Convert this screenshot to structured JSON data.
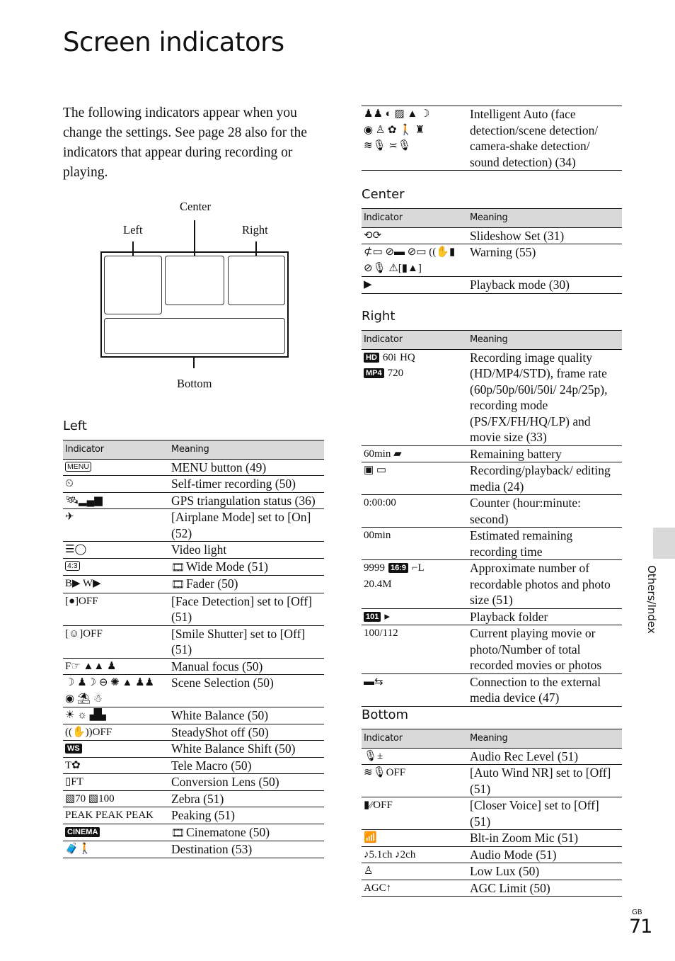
{
  "page": {
    "title": "Screen indicators",
    "intro": "The following indicators appear when you change the settings. See page 28 also for the indicators that appear during recording or playing.",
    "side_tab": "Others/Index",
    "region_code": "GB",
    "page_number": "71"
  },
  "diagram": {
    "labels": {
      "center": "Center",
      "left": "Left",
      "right": "Right",
      "bottom": "Bottom"
    }
  },
  "headers": {
    "indicator": "Indicator",
    "meaning": "Meaning"
  },
  "left": {
    "title": "Left",
    "rows": [
      {
        "icons": [
          "menu-box"
        ],
        "icon_text": "MENU",
        "meaning": "MENU button (49)"
      },
      {
        "icons": [
          "self-timer-icon"
        ],
        "icon_text": "⏲",
        "meaning": "Self-timer recording (50)"
      },
      {
        "icons": [
          "gps-signal-icon"
        ],
        "icon_text": "🛰▂▄▆",
        "meaning": "GPS triangulation status (36)"
      },
      {
        "icons": [
          "airplane-icon"
        ],
        "icon_text": "✈",
        "meaning": "[Airplane Mode] set to [On] (52)"
      },
      {
        "icons": [
          "video-light-icon"
        ],
        "icon_text": "☰◯",
        "meaning": "Video light"
      },
      {
        "icons": [
          "aspect-4-3-icon"
        ],
        "icon_text": "4:3",
        "meaning": "Wide Mode (51)",
        "film_prefix": true
      },
      {
        "icons": [
          "fader-black-icon",
          "fader-white-icon"
        ],
        "icon_text": "B▶ W▶",
        "meaning": "Fader (50)",
        "film_prefix": true
      },
      {
        "icons": [
          "face-detection-off-icon"
        ],
        "icon_text": "[●]OFF",
        "meaning": "[Face Detection] set to [Off] (51)"
      },
      {
        "icons": [
          "smile-shutter-off-icon"
        ],
        "icon_text": "[☺]OFF",
        "meaning": "[Smile Shutter] set to [Off] (51)"
      },
      {
        "icons": [
          "manual-focus-icon",
          "landscape-focus-icon",
          "portrait-focus-icon"
        ],
        "icon_text": "F☞ ▲▲ ♟",
        "meaning": "Manual focus (50)"
      },
      {
        "icons": [
          "night-scene-icon",
          "twilight-portrait-icon",
          "sunrise-sunset-icon",
          "fireworks-icon",
          "landscape-icon",
          "portrait-icon",
          "spotlight-icon",
          "beach-icon",
          "snow-icon"
        ],
        "icon_text": "☽ ♟☽ ⊖ ✺ ▲ ♟♟ ◉ ⛱ ☃",
        "meaning": "Scene Selection (50)"
      },
      {
        "icons": [
          "wb-outdoor-icon",
          "wb-indoor-icon",
          "wb-onepush-icon"
        ],
        "icon_text": "☀ ☼ ▟▙",
        "meaning": "White Balance (50)"
      },
      {
        "icons": [
          "steadyshot-off-icon"
        ],
        "icon_text": "((✋))OFF",
        "meaning": "SteadyShot off (50)"
      },
      {
        "icons": [
          "wb-shift-icon"
        ],
        "icon_text": "WS",
        "meaning": "White Balance Shift (50)"
      },
      {
        "icons": [
          "tele-macro-icon"
        ],
        "icon_text": "T✿",
        "meaning": "Tele Macro (50)"
      },
      {
        "icons": [
          "conversion-lens-icon"
        ],
        "icon_text": "▯FT",
        "meaning": "Conversion Lens (50)"
      },
      {
        "icons": [
          "zebra-70-icon",
          "zebra-100-icon"
        ],
        "icon_text": "▧70 ▧100",
        "meaning": "Zebra (51)"
      },
      {
        "icons": [
          "peaking-w-icon",
          "peaking-r-icon",
          "peaking-y-icon"
        ],
        "icon_text": "PEAK PEAK PEAK",
        "meaning": "Peaking (51)"
      },
      {
        "icons": [
          "cinema-icon"
        ],
        "icon_text": "CINEMA",
        "meaning": "Cinematone (50)",
        "film_prefix": true
      },
      {
        "icons": [
          "destination-icon"
        ],
        "icon_text": "🧳🚶",
        "meaning": "Destination (53)"
      }
    ]
  },
  "intelligent_auto": {
    "icons": [
      "portrait-icon",
      "baby-icon",
      "backlight-icon",
      "landscape-icon",
      "night-icon",
      "spotlight-icon",
      "low-light-icon",
      "macro-icon",
      "walking-icon",
      "tripod-icon",
      "wind-mic-icon",
      "auto-mic-icon"
    ],
    "icon_lines": [
      "♟♟ ◐ ▨ ▲ ☽",
      "◉ ♙ ✿ 🚶 ♜",
      "≋🎙 ≍🎙"
    ],
    "meaning": "Intelligent Auto (face detection/scene detection/ camera-shake detection/ sound detection) (34)"
  },
  "center": {
    "title": "Center",
    "rows": [
      {
        "icons": [
          "slideshow-repeat-icon"
        ],
        "icon_lines": [
          "⟲⟳"
        ],
        "meaning": "Slideshow Set (31)"
      },
      {
        "icons": [
          "battery-warning-icon",
          "media-warning-icon",
          "card-warning-icon",
          "shake-warning-icon",
          "mic-warning-icon",
          "caution-icon"
        ],
        "icon_lines": [
          "⊄▭ ⊘▬ ⊘▭ ((✋▮",
          "⊘🎙 ⚠[▮▲]"
        ],
        "meaning": "Warning (55)"
      },
      {
        "icons": [
          "playback-mode-icon"
        ],
        "icon_lines": [
          "▶"
        ],
        "meaning": "Playback mode (30)"
      }
    ]
  },
  "right": {
    "title": "Right",
    "rows": [
      {
        "icons": [
          "hd-icon",
          "hq-icon",
          "mp4-icon"
        ],
        "icon_lines": [
          "HD|60i|HQ",
          "MP4|720"
        ],
        "meaning": "Recording image quality (HD/MP4/STD), frame rate (60p/50p/60i/50i/ 24p/25p), recording mode (PS/FX/FH/HQ/LP) and movie size (33)"
      },
      {
        "icons": [
          "battery-icon"
        ],
        "icon_lines": [
          "60min ▰"
        ],
        "meaning": "Remaining battery"
      },
      {
        "icons": [
          "internal-memory-icon",
          "memory-card-icon"
        ],
        "icon_lines": [
          "▣ ▭"
        ],
        "meaning": "Recording/playback/ editing media (24)"
      },
      {
        "icons": [],
        "icon_lines": [
          "0:00:00"
        ],
        "meaning": "Counter (hour:minute: second)"
      },
      {
        "icons": [],
        "icon_lines": [
          "00min"
        ],
        "meaning": "Estimated remaining recording time"
      },
      {
        "icons": [
          "aspect-16-9-icon",
          "photo-size-icon"
        ],
        "icon_lines": [
          "9999|16:9|⌐L",
          "20.4M"
        ],
        "meaning": "Approximate number of recordable photos and photo size (51)"
      },
      {
        "icons": [
          "folder-icon"
        ],
        "icon_lines": [
          "101|▸"
        ],
        "meaning": "Playback folder"
      },
      {
        "icons": [],
        "icon_lines": [
          "100/112"
        ],
        "meaning": "Current playing movie or photo/Number of total recorded movies or photos"
      },
      {
        "icons": [
          "external-media-icon"
        ],
        "icon_lines": [
          "▬⇆"
        ],
        "meaning": "Connection to the external media device (47)"
      }
    ]
  },
  "bottom": {
    "title": "Bottom",
    "rows": [
      {
        "icons": [
          "audio-rec-level-icon"
        ],
        "icon_lines": [
          "🎙±"
        ],
        "meaning": "Audio Rec Level (51)"
      },
      {
        "icons": [
          "wind-nr-off-icon"
        ],
        "icon_lines": [
          "≋🎙OFF"
        ],
        "meaning": "[Auto Wind NR] set to [Off] (51)"
      },
      {
        "icons": [
          "closer-voice-off-icon"
        ],
        "icon_lines": [
          "▮⁄⁄OFF"
        ],
        "meaning": "[Closer Voice] set to [Off] (51)"
      },
      {
        "icons": [
          "zoom-mic-icon"
        ],
        "icon_lines": [
          "📶"
        ],
        "meaning": "Blt-in Zoom Mic (51)"
      },
      {
        "icons": [
          "audio-5-1ch-icon",
          "audio-2ch-icon"
        ],
        "icon_lines": [
          "♪5.1ch ♪2ch"
        ],
        "meaning": "Audio Mode (51)"
      },
      {
        "icons": [
          "low-lux-icon"
        ],
        "icon_lines": [
          "♙"
        ],
        "meaning": "Low Lux (50)"
      },
      {
        "icons": [
          "agc-limit-icon"
        ],
        "icon_lines": [
          "AGC↑"
        ],
        "meaning": "AGC Limit (50)"
      }
    ]
  }
}
